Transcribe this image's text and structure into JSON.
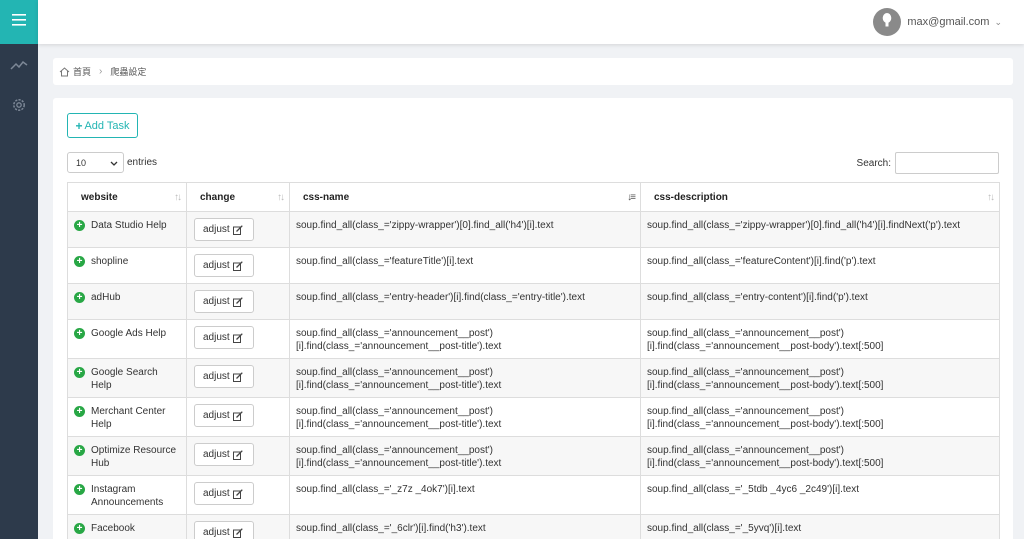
{
  "sidebar": {
    "items": [
      {
        "icon": "chart-line-icon"
      },
      {
        "icon": "gear-icon"
      }
    ]
  },
  "header": {
    "user_email": "max@gmail.com"
  },
  "breadcrumb": {
    "home": "首頁",
    "current": "爬蟲設定"
  },
  "toolbar": {
    "add_label": "Add Task"
  },
  "length": {
    "value": "10",
    "suffix": "entries"
  },
  "search": {
    "label": "Search:",
    "value": ""
  },
  "table": {
    "columns": [
      "website",
      "change",
      "css-name",
      "css-description"
    ],
    "adjust_label": "adjust",
    "rows": [
      {
        "website": "Data Studio Help",
        "css_name": "soup.find_all(class_='zippy-wrapper')[0].find_all('h4')[i].text",
        "css_description": "soup.find_all(class_='zippy-wrapper')[0].find_all('h4')[i].findNext('p').text"
      },
      {
        "website": "shopline",
        "css_name": "soup.find_all(class_='featureTitle')[i].text",
        "css_description": "soup.find_all(class_='featureContent')[i].find('p').text"
      },
      {
        "website": "adHub",
        "css_name": "soup.find_all(class_='entry-header')[i].find(class_='entry-title').text",
        "css_description": "soup.find_all(class_='entry-content')[i].find('p').text"
      },
      {
        "website": "Google Ads Help",
        "css_name": "soup.find_all(class_='announcement__post')[i].find(class_='announcement__post-title').text",
        "css_description": "soup.find_all(class_='announcement__post')[i].find(class_='announcement__post-body').text[:500]"
      },
      {
        "website": "Google Search Help",
        "css_name": "soup.find_all(class_='announcement__post')[i].find(class_='announcement__post-title').text",
        "css_description": "soup.find_all(class_='announcement__post')[i].find(class_='announcement__post-body').text[:500]"
      },
      {
        "website": "Merchant Center Help",
        "css_name": "soup.find_all(class_='announcement__post')[i].find(class_='announcement__post-title').text",
        "css_description": "soup.find_all(class_='announcement__post')[i].find(class_='announcement__post-body').text[:500]"
      },
      {
        "website": "Optimize Resource Hub",
        "css_name": "soup.find_all(class_='announcement__post')[i].find(class_='announcement__post-title').text",
        "css_description": "soup.find_all(class_='announcement__post')[i].find(class_='announcement__post-body').text[:500]"
      },
      {
        "website": "Instagram Announcements",
        "css_name": "soup.find_all(class_='_z7z _4ok7')[i].text",
        "css_description": "soup.find_all(class_='_5tdb _4yc6 _2c49')[i].text"
      },
      {
        "website": "Facebook",
        "css_name": "soup.find_all(class_='_6clr')[i].find('h3').text",
        "css_description": "soup.find_all(class_='_5yvq')[i].text"
      }
    ]
  },
  "colors": {
    "accent": "#23b5b3",
    "sidebar": "#2d3a4b",
    "expand": "#28a745"
  }
}
